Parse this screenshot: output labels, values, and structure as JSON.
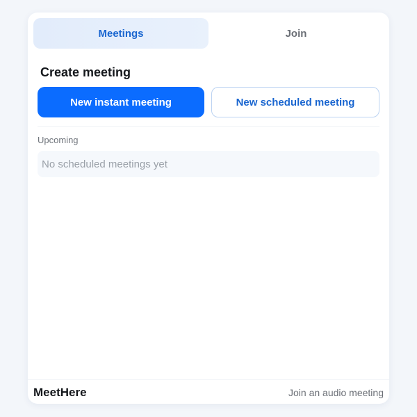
{
  "tabs": [
    {
      "label": "Meetings",
      "active": true
    },
    {
      "label": "Join",
      "active": false
    }
  ],
  "create": {
    "title": "Create meeting",
    "instant_label": "New instant meeting",
    "scheduled_label": "New scheduled meeting"
  },
  "upcoming": {
    "label": "Upcoming",
    "empty_text": "No scheduled meetings yet"
  },
  "footer": {
    "brand": "MeetHere",
    "audio_link": "Join an audio meeting"
  },
  "colors": {
    "accent": "#0b6cff",
    "accent_text": "#1a66d0",
    "background": "#f3f6fa"
  }
}
